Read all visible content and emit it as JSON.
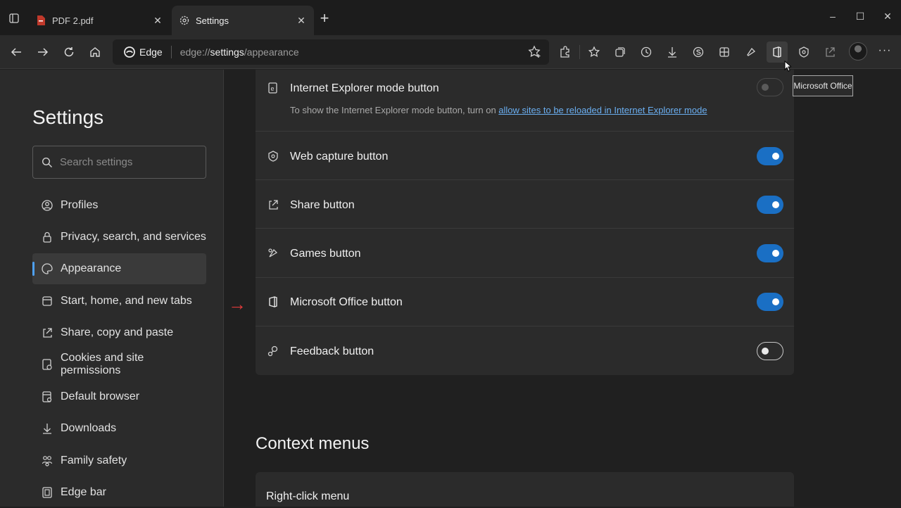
{
  "tabs": [
    {
      "label": "PDF 2.pdf",
      "icon": "pdf-icon",
      "active": false
    },
    {
      "label": "Settings",
      "icon": "gear-icon",
      "active": true
    }
  ],
  "window": {
    "minimize": "–",
    "maximize": "☐",
    "close": "✕"
  },
  "address": {
    "badge": "Edge",
    "url_prefix": "edge://",
    "url_bold": "settings",
    "url_suffix": "/appearance"
  },
  "tooltip": "Microsoft Office",
  "sidebar": {
    "title": "Settings",
    "search_placeholder": "Search settings",
    "items": [
      {
        "label": "Profiles",
        "icon": "profile-icon"
      },
      {
        "label": "Privacy, search, and services",
        "icon": "lock-icon"
      },
      {
        "label": "Appearance",
        "icon": "palette-icon",
        "selected": true
      },
      {
        "label": "Start, home, and new tabs",
        "icon": "home-tabs-icon"
      },
      {
        "label": "Share, copy and paste",
        "icon": "share-icon"
      },
      {
        "label": "Cookies and site permissions",
        "icon": "cookies-icon"
      },
      {
        "label": "Default browser",
        "icon": "browser-icon"
      },
      {
        "label": "Downloads",
        "icon": "download-icon"
      },
      {
        "label": "Family safety",
        "icon": "family-icon"
      },
      {
        "label": "Edge bar",
        "icon": "edge-bar-icon"
      }
    ]
  },
  "settings_rows": [
    {
      "label": "Internet Explorer mode button",
      "icon": "ie-mode-icon",
      "state": "disabled",
      "desc": "To show the Internet Explorer mode button, turn on ",
      "desc_link": "allow sites to be reloaded in Internet Explorer mode"
    },
    {
      "label": "Web capture button",
      "icon": "web-capture-icon",
      "state": "on"
    },
    {
      "label": "Share button",
      "icon": "share-icon",
      "state": "on"
    },
    {
      "label": "Games button",
      "icon": "games-icon",
      "state": "on"
    },
    {
      "label": "Microsoft Office button",
      "icon": "office-icon",
      "state": "on"
    },
    {
      "label": "Feedback button",
      "icon": "feedback-icon",
      "state": "off"
    }
  ],
  "context_menus": {
    "title": "Context menus",
    "first_item": "Right-click menu"
  },
  "colors": {
    "accent": "#1a6fc4",
    "link": "#6aaef0",
    "arrow": "#e03a3a"
  }
}
